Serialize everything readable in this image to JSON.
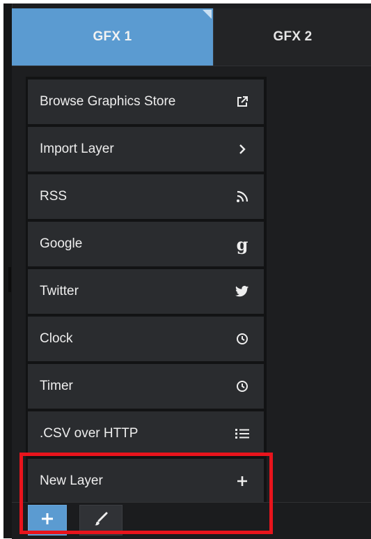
{
  "tabs": [
    {
      "label": "GFX 1",
      "active": true
    },
    {
      "label": "GFX 2",
      "active": false
    }
  ],
  "menu": {
    "items": [
      {
        "label": "Browse Graphics Store",
        "icon": "external-link-icon"
      },
      {
        "label": "Import Layer",
        "icon": "chevron-right-icon"
      },
      {
        "label": "RSS",
        "icon": "rss-icon"
      },
      {
        "label": "Google",
        "icon": "google-icon"
      },
      {
        "label": "Twitter",
        "icon": "twitter-icon"
      },
      {
        "label": "Clock",
        "icon": "clock-icon"
      },
      {
        "label": "Timer",
        "icon": "clock-icon"
      },
      {
        "label": ".CSV over HTTP",
        "icon": "list-icon"
      },
      {
        "label": "New Layer",
        "icon": "plus-icon"
      }
    ]
  },
  "toolbar": {
    "add_icon": "plus-icon",
    "brush_icon": "brush-icon"
  },
  "colors": {
    "accent_blue": "#5b9bd1",
    "menu_item_bg": "#2a2c2f",
    "highlight_red": "#e8141c"
  }
}
